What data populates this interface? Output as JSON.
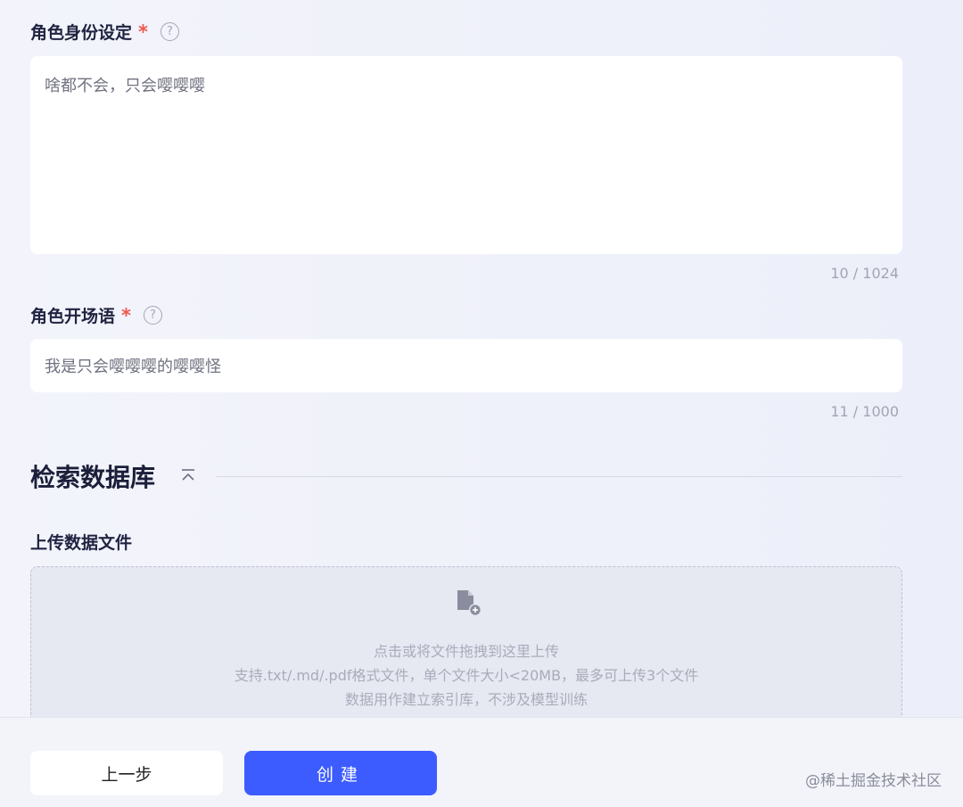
{
  "role_setting": {
    "label": "角色身份设定",
    "required_mark": "*",
    "help_glyph": "?",
    "value": "啥都不会，只会嘤嘤嘤",
    "counter": "10 / 1024"
  },
  "opening_line": {
    "label": "角色开场语",
    "required_mark": "*",
    "help_glyph": "?",
    "value": "我是只会嘤嘤嘤的嘤嘤怪",
    "counter": "11 / 1000"
  },
  "retrieval_db": {
    "title": "检索数据库",
    "upload_label": "上传数据文件",
    "dropzone": {
      "line1": "点击或将文件拖拽到这里上传",
      "line2": "支持.txt/.md/.pdf格式文件，单个文件大小<20MB，最多可上传3个文件",
      "line3": "数据用作建立索引库，不涉及模型训练"
    }
  },
  "footer": {
    "prev_label": "上一步",
    "create_label": "创建",
    "watermark": "@稀土掘金技术社区"
  },
  "colors": {
    "primary": "#3d5cff",
    "required": "#f0584d"
  }
}
